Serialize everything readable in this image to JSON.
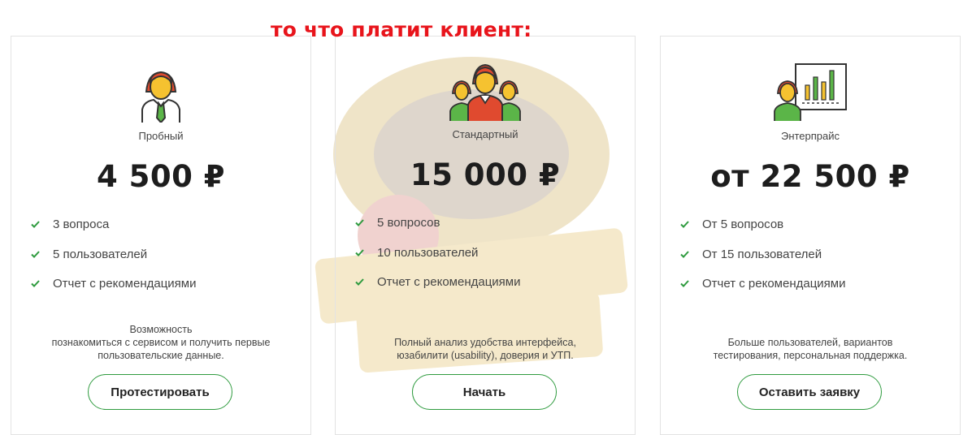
{
  "overlay_note": "то что платит клиент:",
  "colors": {
    "accent_green": "#2f9b3f",
    "overlay_red": "#e8141b",
    "icon_red": "#e04a2f",
    "icon_yellow": "#f5c230",
    "icon_green": "#5bb548"
  },
  "plans": [
    {
      "icon": "single-person-icon",
      "name": "Пробный",
      "price": "4 500 ₽",
      "features": [
        "3 вопроса",
        "5 пользователей",
        "Отчет с рекомендациями"
      ],
      "description_line1": "Возможность",
      "description_line2": "познакомиться с сервисом и получить первые",
      "description_line3": "пользовательские данные.",
      "button": "Протестировать"
    },
    {
      "icon": "team-icon",
      "name": "Стандартный",
      "price": "15 000 ₽",
      "features": [
        "5 вопросов",
        "10 пользователей",
        "Отчет с рекомендациями"
      ],
      "description_line1": "Полный анализ удобства интерфейса,",
      "description_line2": "юзабилити (usability), доверия и УТП.",
      "button": "Начать"
    },
    {
      "icon": "presenter-chart-icon",
      "name": "Энтерпрайс",
      "price": "от 22 500 ₽",
      "features": [
        "От 5 вопросов",
        "От 15 пользователей",
        "Отчет с рекомендациями"
      ],
      "description_line1": "Больше пользователей, вариантов",
      "description_line2": "тестирования, персональная поддержка.",
      "button": "Оставить заявку"
    }
  ]
}
